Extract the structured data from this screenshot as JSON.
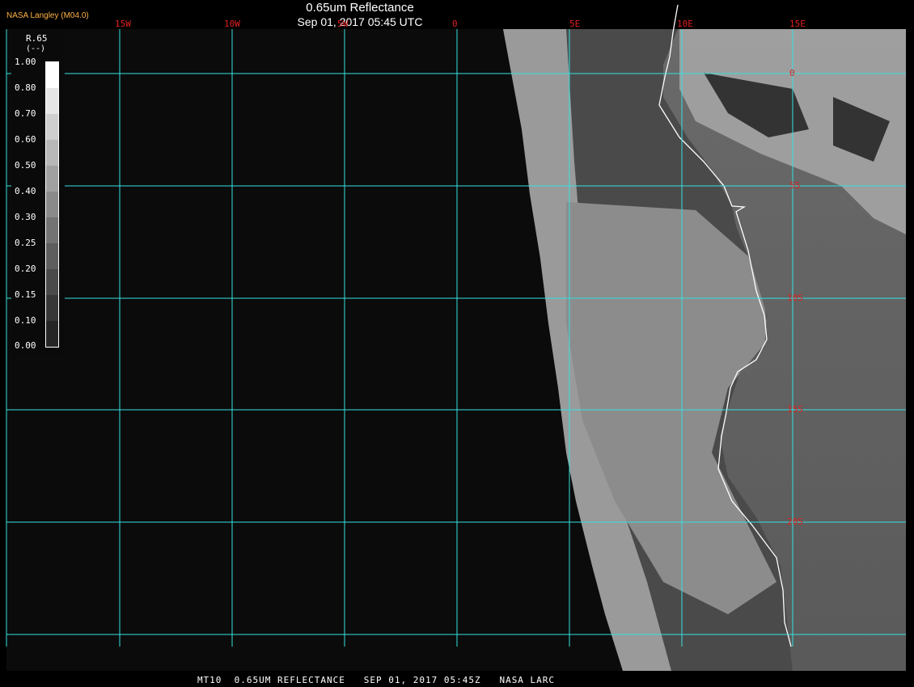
{
  "header": {
    "organization": "NASA Langley (M04.0)",
    "title": "0.65um Reflectance",
    "datetime": "Sep 01, 2017 05:45 UTC"
  },
  "longitude_labels": [
    "15W",
    "10W",
    "5W",
    "0",
    "5E",
    "10E",
    "15E"
  ],
  "latitude_labels": [
    "0",
    "5S",
    "10S",
    "15S",
    "20S"
  ],
  "legend": {
    "title": "R.65",
    "unit": "(--)",
    "ticks": [
      "1.00",
      "0.80",
      "0.70",
      "0.60",
      "0.50",
      "0.40",
      "0.30",
      "0.25",
      "0.20",
      "0.15",
      "0.10",
      "0.00"
    ]
  },
  "footer": "MT10  0.65UM REFLECTANCE   SEP 01, 2017 05:45Z   NASA LARC",
  "colors": {
    "grid": "#36e0e0",
    "labels": "#e02020",
    "space": "#0b0b0b",
    "coastline": "#ffffff"
  }
}
